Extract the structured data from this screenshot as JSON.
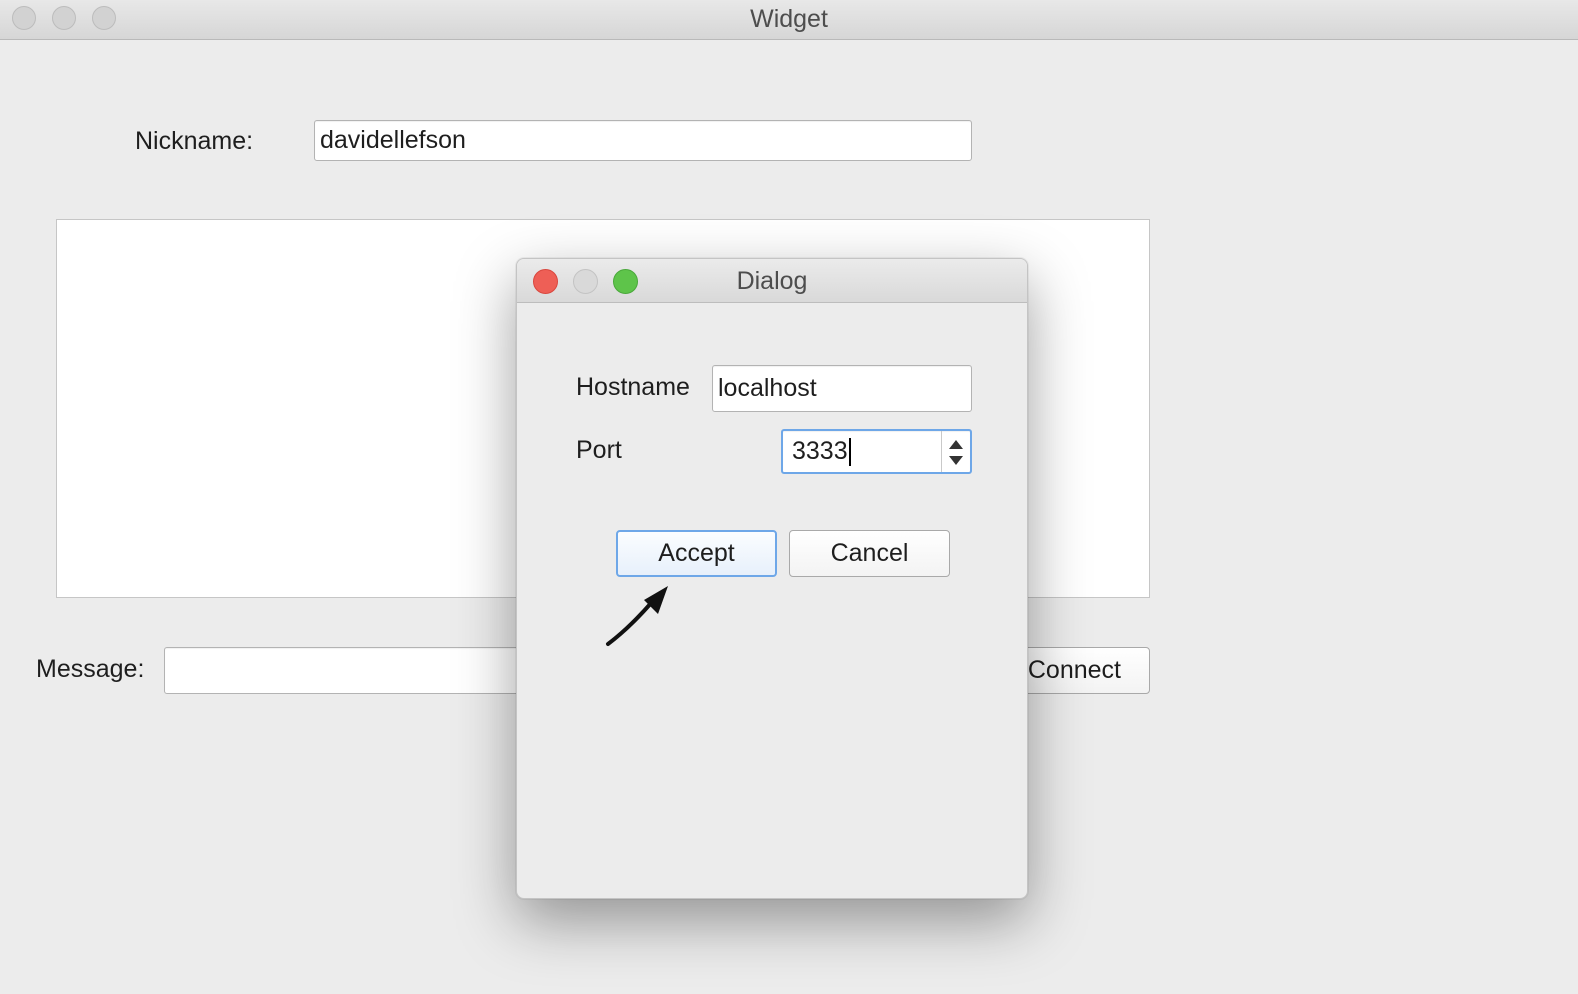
{
  "window": {
    "title": "Widget"
  },
  "main": {
    "nickname_label": "Nickname:",
    "nickname_value": "davidellefson",
    "message_label": "Message:",
    "message_value": "",
    "connect_label": "Connect"
  },
  "dialog": {
    "title": "Dialog",
    "hostname_label": "Hostname",
    "hostname_value": "localhost",
    "port_label": "Port",
    "port_value": "3333",
    "accept_label": "Accept",
    "cancel_label": "Cancel"
  },
  "colors": {
    "close": "#ee5f56",
    "minimize_inactive": "#d9d9d9",
    "zoom": "#5ec44a",
    "focus_ring": "#6ea7e8"
  },
  "icons": {
    "annotation": "arrow-pointer-icon",
    "spinner": "spin-up-down-icon"
  }
}
